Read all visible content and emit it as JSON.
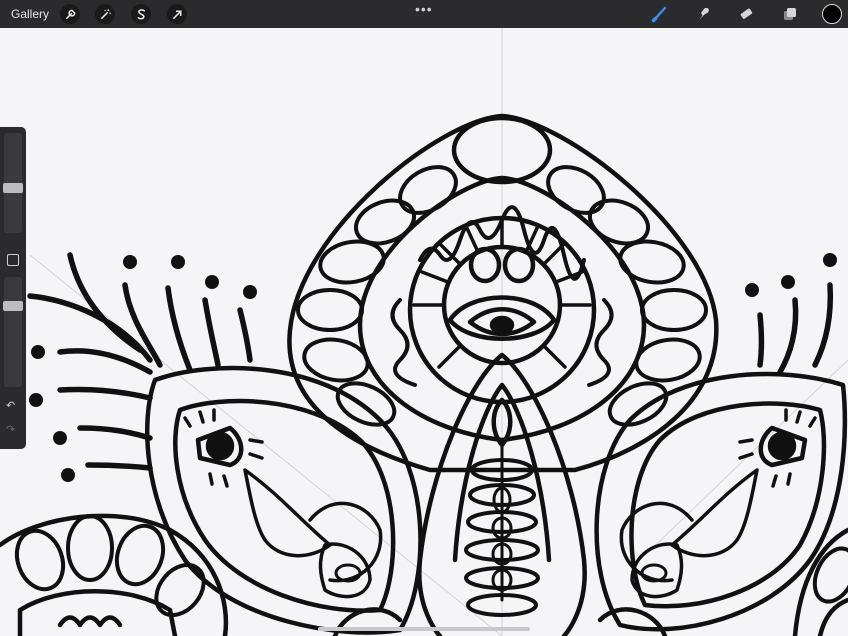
{
  "toolbar": {
    "gallery_label": "Gallery",
    "left_tools": [
      "wrench-icon",
      "magic-wand-icon",
      "selection-icon",
      "transform-arrow-icon"
    ],
    "more_label": "•••",
    "right_tools": [
      "brush-icon",
      "smudge-icon",
      "eraser-icon",
      "layers-icon"
    ],
    "active_tool": "brush-icon",
    "active_color": "#000000",
    "accent_color": "#3a8ef6"
  },
  "sidebar": {
    "brush_size": 0.45,
    "opacity": 0.76,
    "undo_icon": "↶",
    "redo_icon": "↷"
  }
}
